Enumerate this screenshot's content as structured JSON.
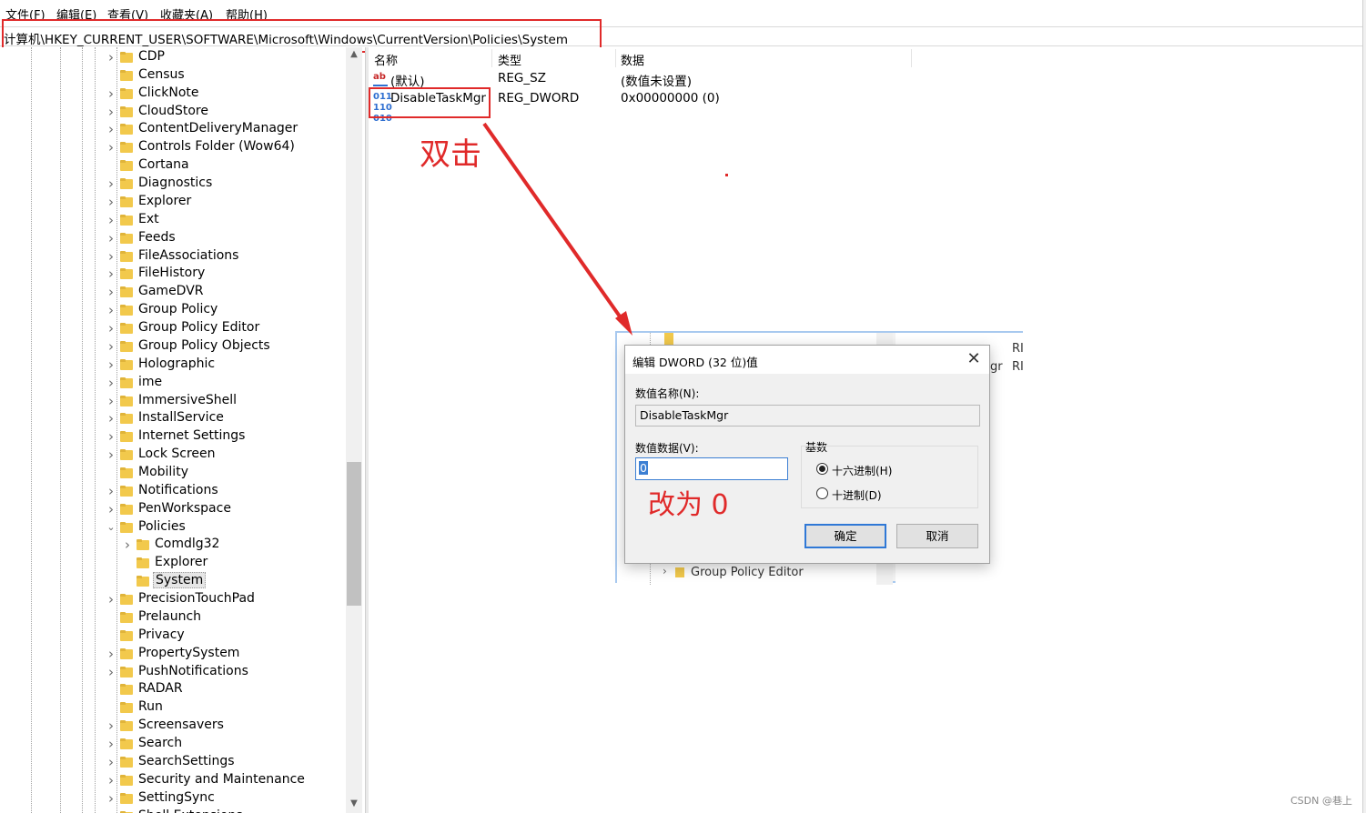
{
  "menubar": {
    "file": "文件(F)",
    "edit": "编辑(E)",
    "view": "查看(V)",
    "favorites": "收藏夹(A)",
    "help": "帮助(H)"
  },
  "address": "计算机\\HKEY_CURRENT_USER\\SOFTWARE\\Microsoft\\Windows\\CurrentVersion\\Policies\\System",
  "tree": {
    "items": [
      {
        "label": "CDP",
        "expander": true
      },
      {
        "label": "Census",
        "expander": false
      },
      {
        "label": "ClickNote",
        "expander": true
      },
      {
        "label": "CloudStore",
        "expander": true
      },
      {
        "label": "ContentDeliveryManager",
        "expander": true
      },
      {
        "label": "Controls Folder (Wow64)",
        "expander": true
      },
      {
        "label": "Cortana",
        "expander": false
      },
      {
        "label": "Diagnostics",
        "expander": true
      },
      {
        "label": "Explorer",
        "expander": true
      },
      {
        "label": "Ext",
        "expander": true
      },
      {
        "label": "Feeds",
        "expander": true
      },
      {
        "label": "FileAssociations",
        "expander": true
      },
      {
        "label": "FileHistory",
        "expander": true
      },
      {
        "label": "GameDVR",
        "expander": true
      },
      {
        "label": "Group Policy",
        "expander": true
      },
      {
        "label": "Group Policy Editor",
        "expander": true
      },
      {
        "label": "Group Policy Objects",
        "expander": true
      },
      {
        "label": "Holographic",
        "expander": true
      },
      {
        "label": "ime",
        "expander": true
      },
      {
        "label": "ImmersiveShell",
        "expander": true
      },
      {
        "label": "InstallService",
        "expander": true
      },
      {
        "label": "Internet Settings",
        "expander": true
      },
      {
        "label": "Lock Screen",
        "expander": true
      },
      {
        "label": "Mobility",
        "expander": false
      },
      {
        "label": "Notifications",
        "expander": true
      },
      {
        "label": "PenWorkspace",
        "expander": true
      },
      {
        "label": "Policies",
        "expander": true,
        "expanded": true
      },
      {
        "label": "Comdlg32",
        "expander": true,
        "child": true
      },
      {
        "label": "Explorer",
        "expander": false,
        "child": true
      },
      {
        "label": "System",
        "expander": false,
        "child": true,
        "selected": true
      },
      {
        "label": "PrecisionTouchPad",
        "expander": true
      },
      {
        "label": "Prelaunch",
        "expander": false
      },
      {
        "label": "Privacy",
        "expander": false
      },
      {
        "label": "PropertySystem",
        "expander": true
      },
      {
        "label": "PushNotifications",
        "expander": true
      },
      {
        "label": "RADAR",
        "expander": false
      },
      {
        "label": "Run",
        "expander": false
      },
      {
        "label": "Screensavers",
        "expander": true
      },
      {
        "label": "Search",
        "expander": true
      },
      {
        "label": "SearchSettings",
        "expander": true
      },
      {
        "label": "Security and Maintenance",
        "expander": true
      },
      {
        "label": "SettingSync",
        "expander": true
      },
      {
        "label": "Shell Extensions",
        "expander": true
      }
    ]
  },
  "list": {
    "headers": {
      "name": "名称",
      "type": "类型",
      "data": "数据"
    },
    "rows": [
      {
        "icon": "string-value-icon",
        "name": "(默认)",
        "type": "REG_SZ",
        "data": "(数值未设置)"
      },
      {
        "icon": "binary-value-icon",
        "name": "DisableTaskMgr",
        "type": "REG_DWORD",
        "data": "0x00000000 (0)"
      }
    ]
  },
  "annotations": {
    "double_click": "双击",
    "change_to_zero": "改为 0"
  },
  "inset_background": {
    "tree_item": "Group Policy Editor",
    "right_fragment_1": "RI",
    "right_fragment_2": "gr",
    "right_fragment_3": "RI"
  },
  "dialog": {
    "title": "编辑 DWORD (32 位)值",
    "name_label": "数值名称(N):",
    "name_value": "DisableTaskMgr",
    "data_label": "数值数据(V):",
    "data_value": "0",
    "base_label": "基数",
    "hex_label": "十六进制(H)",
    "dec_label": "十进制(D)",
    "ok": "确定",
    "cancel": "取消",
    "selected_base": "hex"
  },
  "watermark": "CSDN @巷上",
  "colors": {
    "annotation": "#e02a2a",
    "folder": "#f2c94c",
    "focus": "#2f78d6"
  }
}
